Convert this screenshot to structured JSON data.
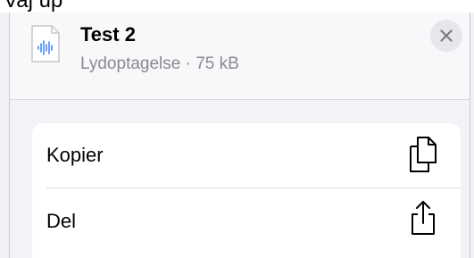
{
  "partial_top_text": "Vaj up",
  "file": {
    "title": "Test 2",
    "subtitle": "Lydoptagelse · 75 kB",
    "icon": "audio-waveform-icon"
  },
  "close": {
    "icon": "close-icon",
    "glyph": "×"
  },
  "actions": [
    {
      "label": "Kopier",
      "icon": "copy-icon"
    },
    {
      "label": "Del",
      "icon": "share-icon"
    }
  ],
  "colors": {
    "waveform_accent": "#3a82f7",
    "secondary_text": "#8a8a8e",
    "close_bg": "#e6e6eb"
  }
}
